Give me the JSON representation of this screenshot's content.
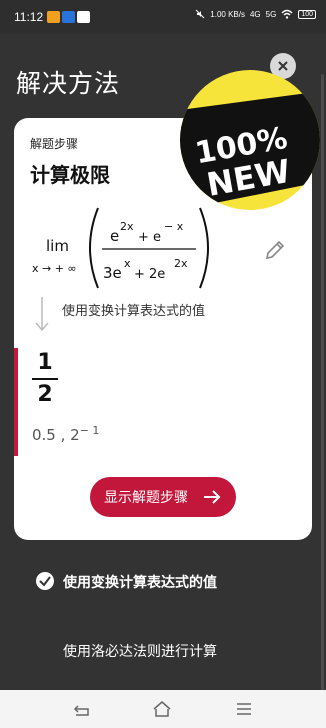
{
  "status_bar": {
    "time": "11:12",
    "speed": "1.00 KB/s",
    "network": "4G",
    "network2": "5G",
    "battery": "100"
  },
  "header": {
    "title": "解决方法"
  },
  "badge": {
    "text_line1": "100%",
    "text_line2": "NEW"
  },
  "card": {
    "steps_label": "解题步骤",
    "calc_title": "计算极限",
    "limit": {
      "lim": "lim",
      "approach": "x → + ∞",
      "numerator": "e^{2x} + e^{-x}",
      "denominator": "3e^{x} + 2e^{2x}"
    },
    "step_hint": "使用变换计算表达式的值",
    "result_num": "1",
    "result_den": "2",
    "alt_value": "0.5 , 2",
    "alt_exp": "− 1",
    "show_steps_button": "显示解题步骤"
  },
  "steps_list": [
    {
      "label": "使用变换计算表达式的值",
      "checked": true
    },
    {
      "label": "使用洛必达法则进行计算",
      "checked": false
    }
  ],
  "colors": {
    "accent": "#c2173b",
    "badge_yellow": "#f6e43a"
  }
}
